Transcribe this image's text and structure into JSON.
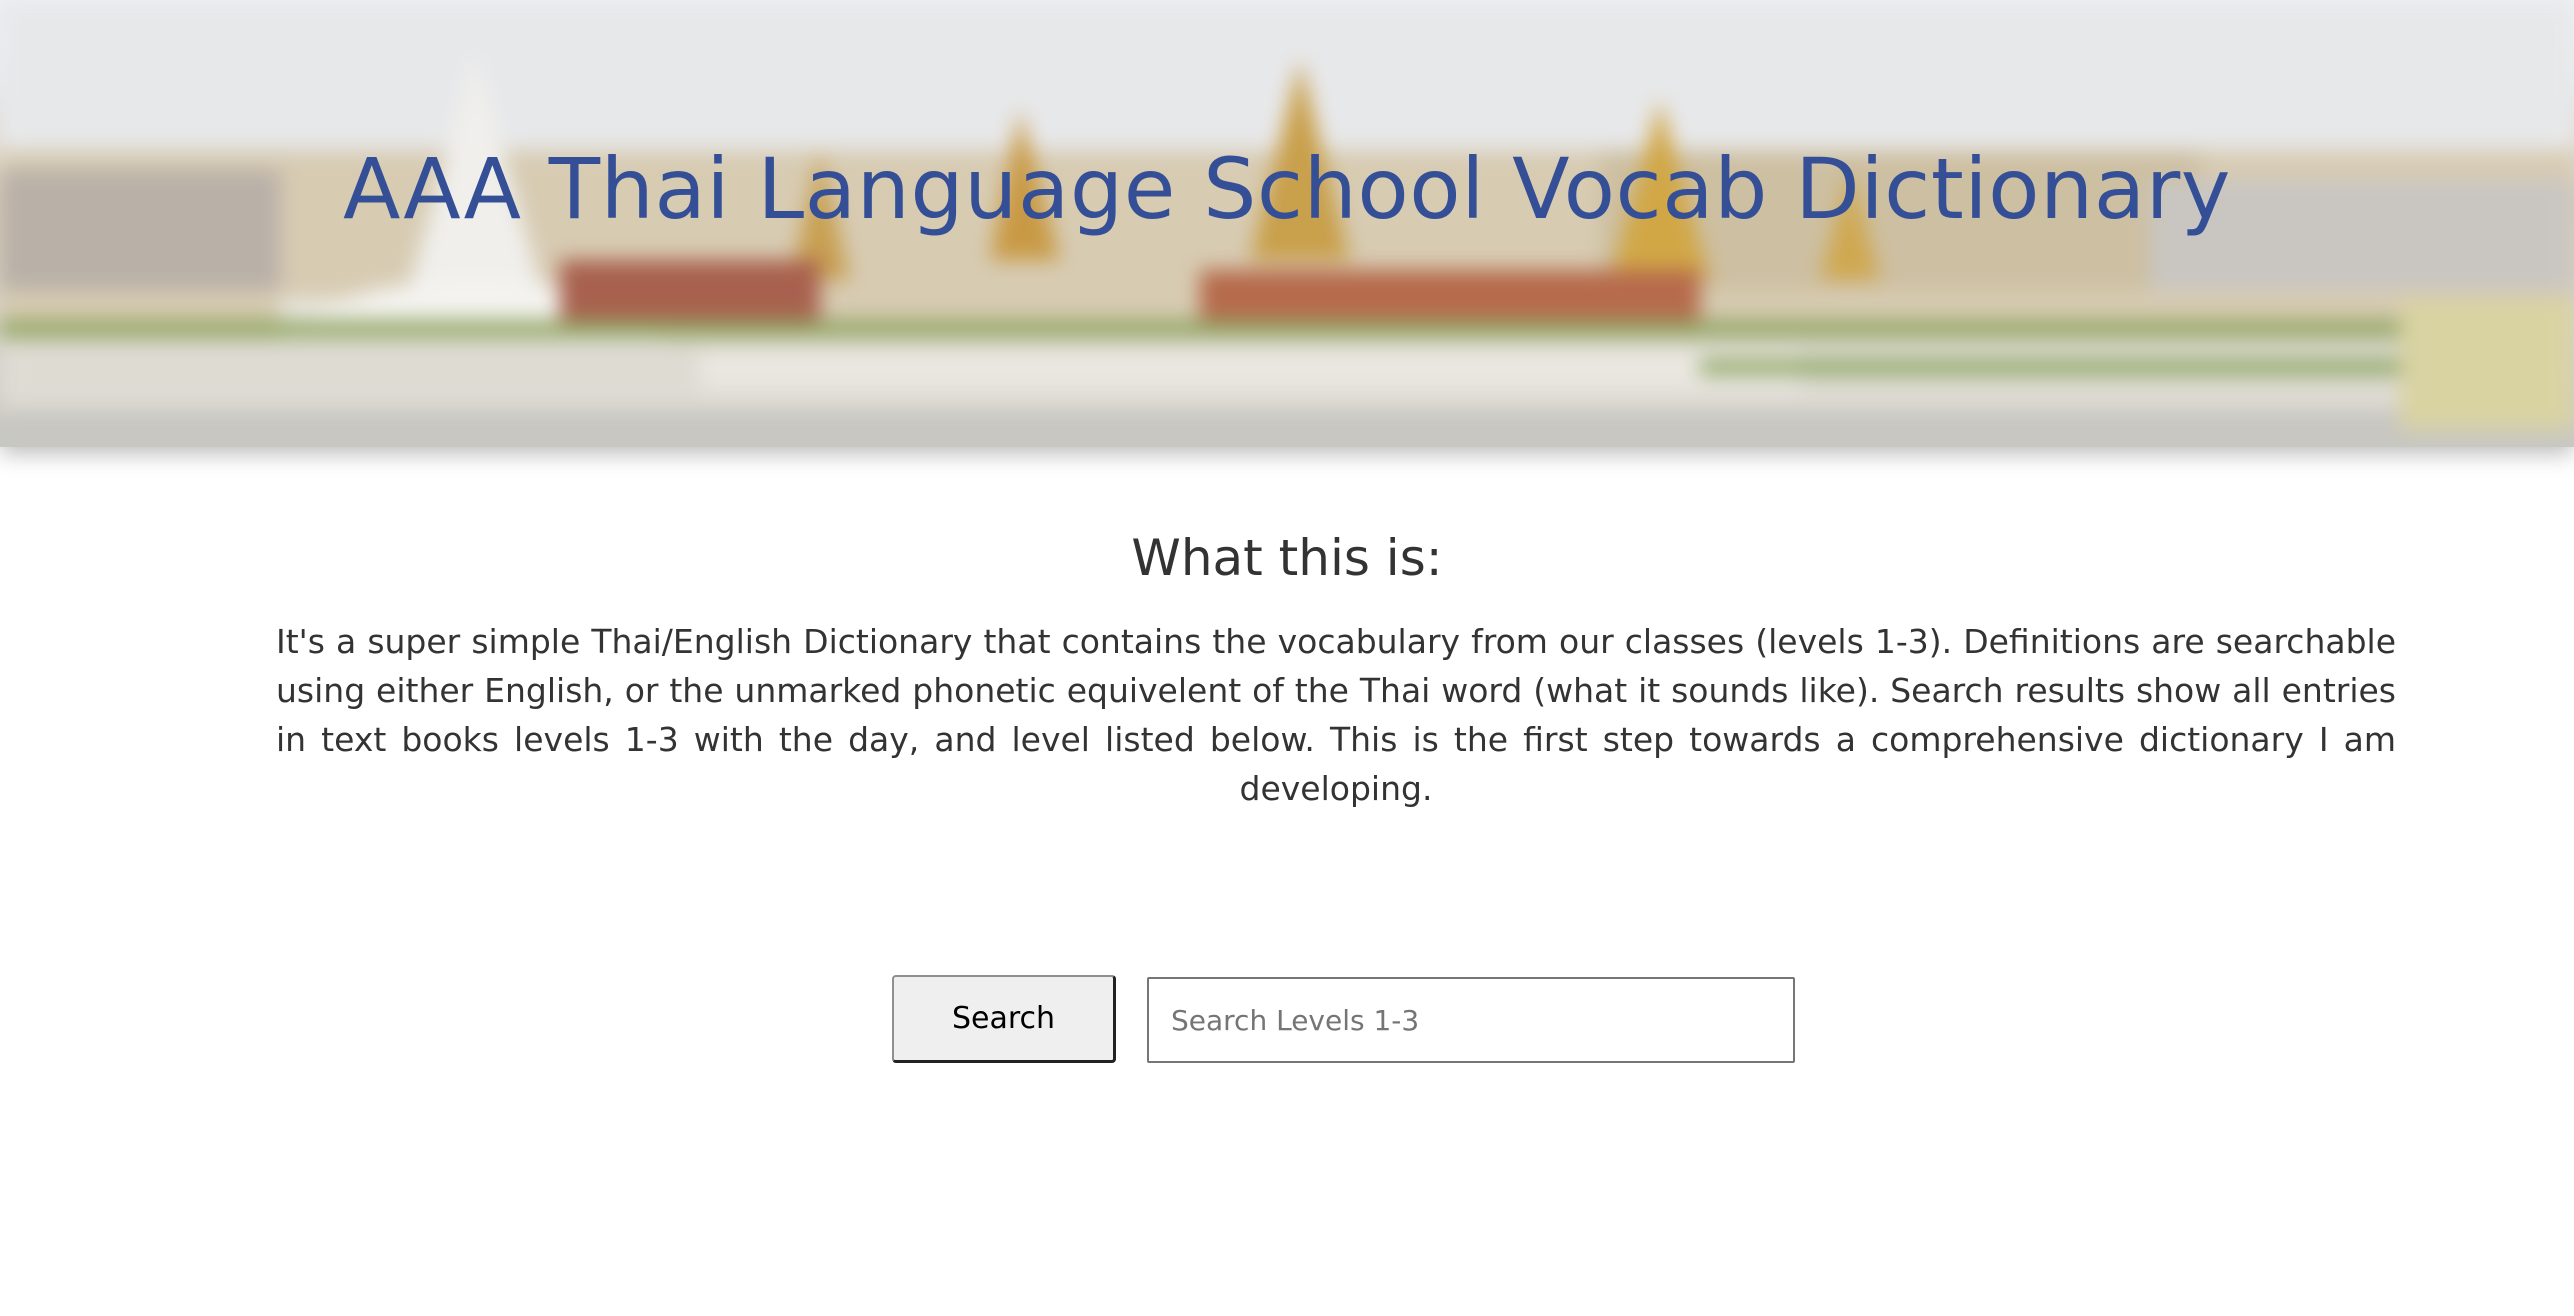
{
  "header": {
    "title": "AAA Thai Language School Vocab Dictionary"
  },
  "about": {
    "heading": "What this is:",
    "body": "It's a super simple Thai/English Dictionary that contains the vocabulary from our classes (levels 1-3). Definitions are searchable using either English, or the unmarked phonetic equivelent of the Thai word (what it sounds like). Search results show all entries in text books levels 1-3 with the day, and level listed below. This is the first step towards a comprehensive dictionary I am developing."
  },
  "search": {
    "button_label": "Search",
    "placeholder": "Search Levels 1-3",
    "value": ""
  },
  "colors": {
    "title": "#354f97",
    "text": "#333333",
    "button_bg": "#efefef"
  }
}
